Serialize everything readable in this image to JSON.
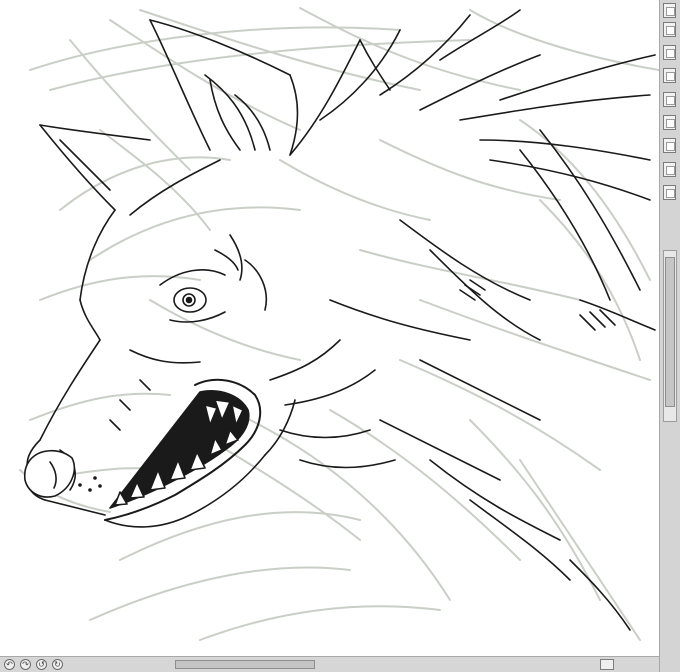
{
  "app": {
    "canvas": {
      "subject": "wolf-lineart",
      "background": "#ffffff",
      "ink": "#1a1a1a",
      "sketch": "#c9cfc6"
    },
    "right_panel": {
      "buttons": 9,
      "scrollbar": "vertical"
    },
    "bottom_bar": {
      "icons": [
        "undo-icon",
        "redo-icon",
        "rotate-left-icon",
        "rotate-right-icon"
      ],
      "scrollbar": "horizontal"
    }
  }
}
